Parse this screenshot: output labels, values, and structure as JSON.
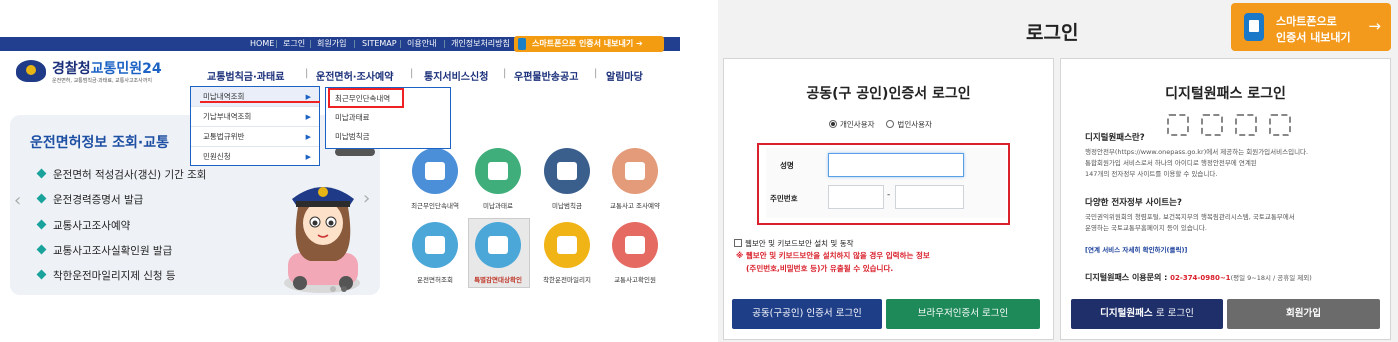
{
  "left": {
    "util_nav": [
      "HOME",
      "로그인",
      "회원가입",
      "SITEMAP",
      "이용안내",
      "개인정보처리방침"
    ],
    "cert_export": "스마트폰으로 인증서 내보내기",
    "logo_title_a": "경찰청",
    "logo_title_b": "교통민원24",
    "logo_sub": "운전면허, 교통범칙금·과태료, 교통사고조사까지",
    "gnav": [
      "교통범칙금·과태료",
      "운전면허·조사예약",
      "통지서비스신청",
      "우편물반송공고",
      "알림마당"
    ],
    "dropdown": [
      "미납내역조회",
      "기납부내역조회",
      "교통법규위반",
      "민원신청"
    ],
    "submenu": [
      "최근무인단속내역",
      "미납과태료",
      "미납범칙금"
    ],
    "hero_title": "운전면허정보 조회·교통",
    "hero_items": [
      "운전면허 적성검사(갱신) 기간 조회",
      "운전경력증명서 발급",
      "교통사고조사예약",
      "교통사고조사실확인원 발급",
      "착한운전마일리지제 신청 등"
    ],
    "services": [
      {
        "label": "최근무인단속내역",
        "color": "#4a8fd8"
      },
      {
        "label": "미납과태료",
        "color": "#3fae7a"
      },
      {
        "label": "미납범칙금",
        "color": "#3b5f8c"
      },
      {
        "label": "교통사고 조사예약",
        "color": "#e39b7a"
      },
      {
        "label": "운전면허조회",
        "color": "#4aa7d8"
      },
      {
        "label": "특별감면대상확인",
        "color": "#4aa7d8"
      },
      {
        "label": "착한운전마일리지",
        "color": "#f1b417"
      },
      {
        "label": "교통사고확인원",
        "color": "#e56a62"
      }
    ]
  },
  "right": {
    "title": "로그인",
    "export_l1": "스마트폰으로",
    "export_l2": "인증서 내보내기",
    "export_arrow": "→",
    "cert_box": {
      "title": "공동(구 공인)인증서 로그인",
      "radio_personal": "개인사용자",
      "radio_corp": "법인사용자",
      "name_label": "성명",
      "rrn_label": "주민번호",
      "dash": "-",
      "security_check": "웹보안 및 키보드보안 설치 및 동작",
      "warn1": "※ 웹보안 및 키보드보안을 설치하지 않을 경우 입력하는 정보",
      "warn2": "(주민번호,비밀번호 등)가 유출될 수 있습니다.",
      "btn_cert": "공동(구공인) 인증서 로그인",
      "btn_browser": "브라우저인증서 로그인"
    },
    "dp_box": {
      "title": "디지털원패스 로그인",
      "q1": "디지털원패스란?",
      "a1_1": "행정안전부(https://www.onepass.go.kr)에서 제공하는 회원가입서비스입니다.",
      "a1_2": "통합회원가입 서비스로서 하나의 아이디로 행정안전부에 연계된",
      "a1_3": "147개의 전자정부 사이트를 이용할 수 있습니다.",
      "q2": "다양한 전자정부 사이트는?",
      "a2_1": "국민권익위원회의 청렴포털, 보건복지부의 행복림관리시스템, 국토교통부에서",
      "a2_2": "운영하는 국토교통부홈페이지 등이 있습니다.",
      "link": "[연계 서비스 자세히 확인하기(클릭)]",
      "contact_label": "디지털원패스 이용문의 :",
      "contact_phone": "02-374-0980~1",
      "contact_hours": "(평일 9~18시 / 공휴일 제외)",
      "btn_dp_bold": "디지털원패스",
      "btn_dp_rest": "로 로그인",
      "btn_join": "회원가입"
    }
  }
}
